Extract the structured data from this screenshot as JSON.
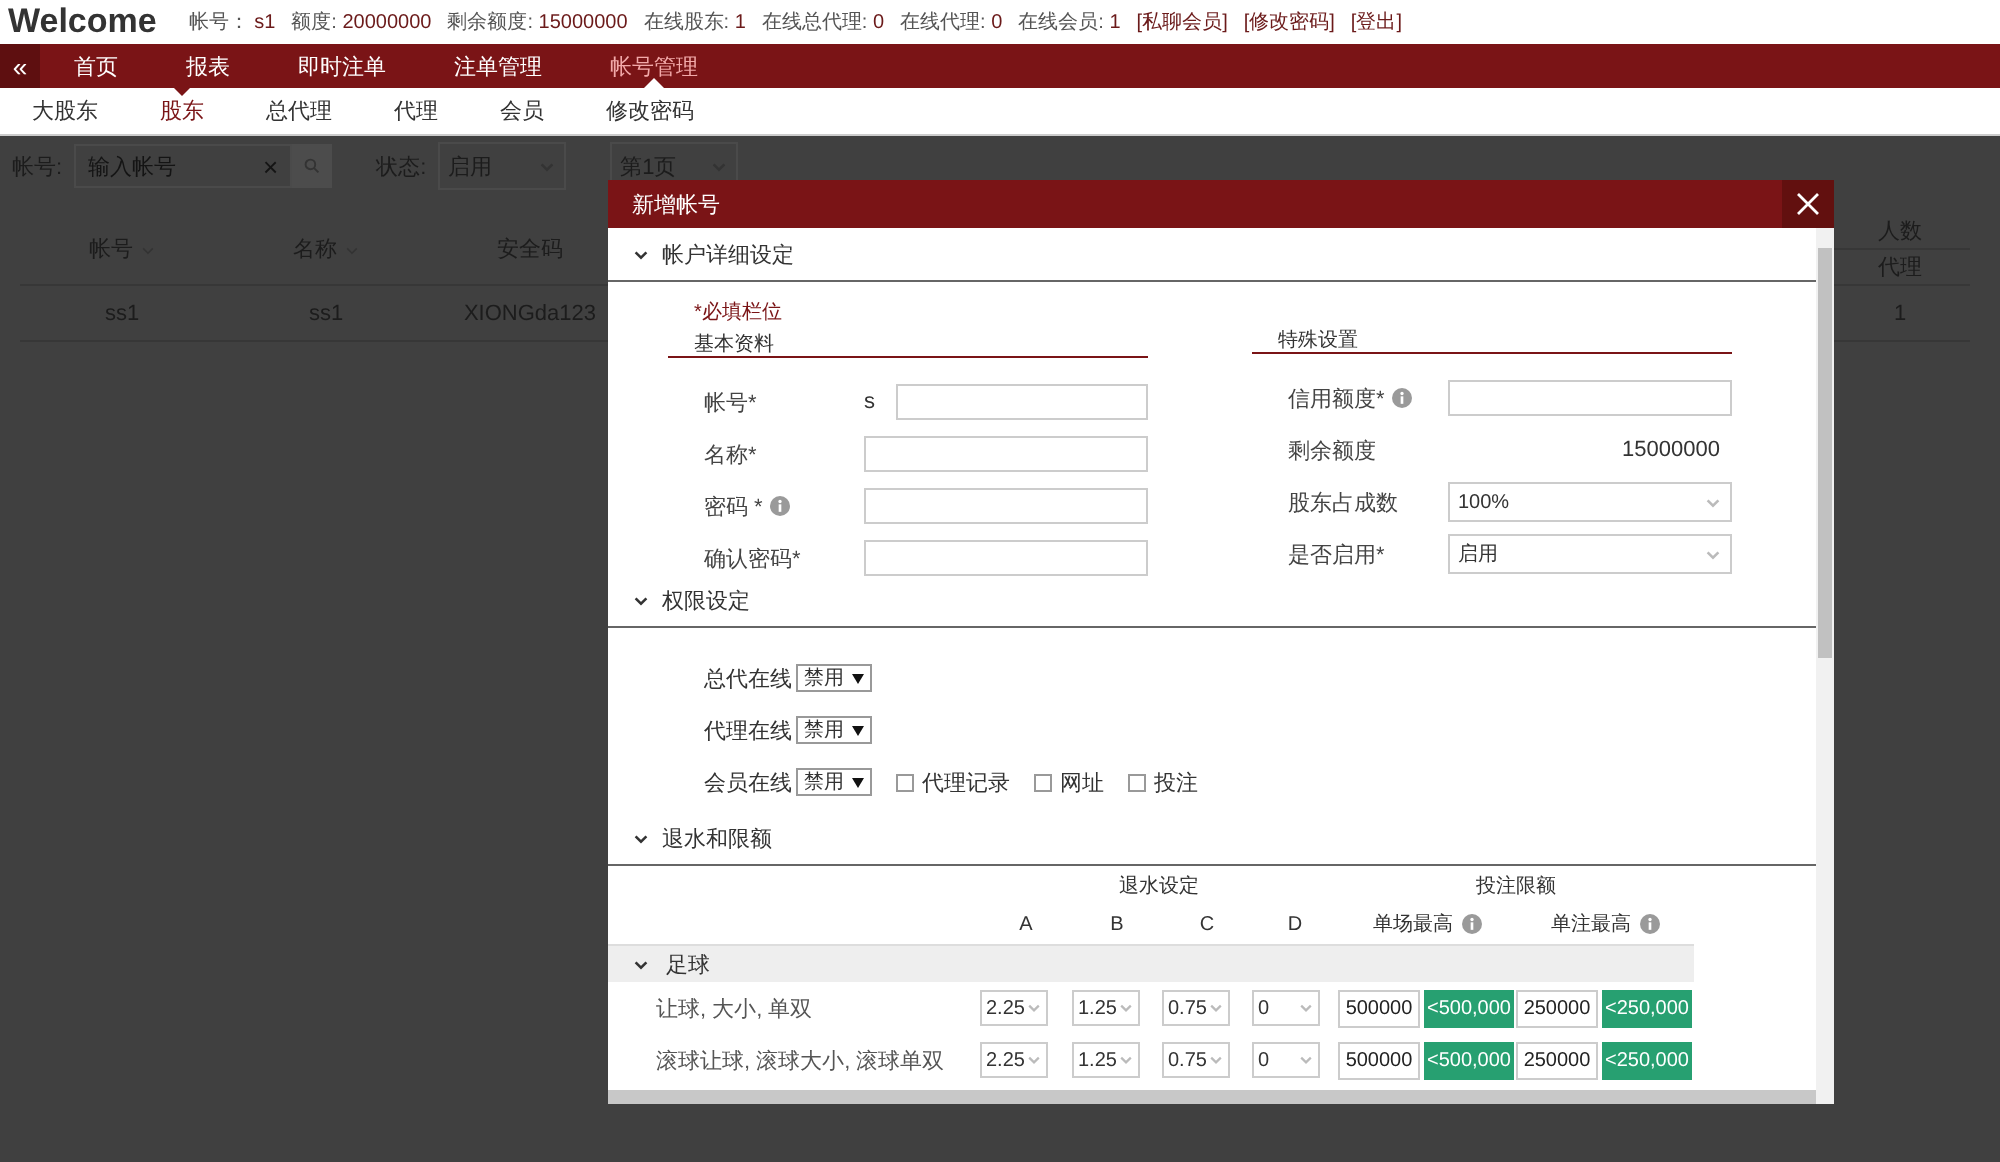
{
  "header": {
    "title": "Welcome",
    "stats": [
      {
        "label": "帐号：",
        "value": "s1"
      },
      {
        "label": "额度:",
        "value": "20000000"
      },
      {
        "label": "剩余额度:",
        "value": "15000000"
      },
      {
        "label": "在线股东:",
        "value": "1"
      },
      {
        "label": "在线总代理:",
        "value": "0"
      },
      {
        "label": "在线代理:",
        "value": "0"
      },
      {
        "label": "在线会员:",
        "value": "1"
      }
    ],
    "links": [
      "[私聊会员]",
      "[修改密码]",
      "[登出]"
    ]
  },
  "nav": {
    "collapse": "«",
    "items": [
      {
        "label": "首页",
        "selected": false
      },
      {
        "label": "报表",
        "selected": false
      },
      {
        "label": "即时注单",
        "selected": false
      },
      {
        "label": "注单管理",
        "selected": false
      },
      {
        "label": "帐号管理",
        "selected": true
      }
    ]
  },
  "subnav": [
    {
      "label": "大股东",
      "selected": false
    },
    {
      "label": "股东",
      "selected": true
    },
    {
      "label": "总代理",
      "selected": false
    },
    {
      "label": "代理",
      "selected": false
    },
    {
      "label": "会员",
      "selected": false
    },
    {
      "label": "修改密码",
      "selected": false
    }
  ],
  "filters": {
    "account_label": "帐号:",
    "placeholder": "输入帐号",
    "clear": "×",
    "status_label": "状态:",
    "status": "启用",
    "page": "第1页"
  },
  "table": {
    "columns": [
      {
        "label": "帐号",
        "sortable": true
      },
      {
        "label": "名称",
        "sortable": true
      },
      {
        "label": "安全码",
        "sortable": false
      }
    ],
    "last_column": {
      "title": "人数",
      "sub": "代理"
    },
    "rows": [
      {
        "cells": [
          "ss1",
          "ss1",
          "XIONGda123"
        ],
        "last": "1"
      }
    ]
  },
  "dialog": {
    "title": "新增帐号",
    "account": {
      "title": "帐户详细设定",
      "expanded": true,
      "required_note": "*必填栏位",
      "basic_title": "基本资料",
      "special_title": "特殊设置",
      "basic_fields": [
        {
          "label": "帐号*",
          "prefix": "s",
          "info": false
        },
        {
          "label": "名称*",
          "info": false
        },
        {
          "label": "密码 *",
          "info": true
        },
        {
          "label": "确认密码*",
          "info": false
        }
      ],
      "special_fields": [
        {
          "kind": "input",
          "label": "信用额度*",
          "info": true
        },
        {
          "kind": "text",
          "label": "剩余额度",
          "value": "15000000"
        },
        {
          "kind": "select",
          "label": "股东占成数",
          "value": "100%"
        },
        {
          "kind": "select",
          "label": "是否启用*",
          "value": "启用"
        }
      ]
    },
    "permissions": {
      "title": "权限设定",
      "expanded": true,
      "rows": [
        {
          "label": "总代在线",
          "value": "禁用"
        },
        {
          "label": "代理在线",
          "value": "禁用"
        },
        {
          "label": "会员在线",
          "value": "禁用",
          "checkboxes": [
            {
              "label": "代理记录",
              "checked": false
            },
            {
              "label": "网址",
              "checked": false
            },
            {
              "label": "投注",
              "checked": false
            }
          ]
        }
      ]
    },
    "limits": {
      "title": "退水和限额",
      "expanded": true,
      "group_rebate": "退水设定",
      "group_limit": "投注限额",
      "rebate_columns": [
        "A",
        "B",
        "C",
        "D"
      ],
      "limit_columns": [
        {
          "label": "单场最高",
          "info": true
        },
        {
          "label": "单注最高",
          "info": true
        }
      ],
      "categories": [
        {
          "name": "足球",
          "expanded": true,
          "rows": [
            {
              "label": "让球, 大小, 单双",
              "rebates": [
                "2.25",
                "1.25",
                "0.75",
                "0"
              ],
              "match_max": "500000",
              "match_badge": "<500,000",
              "bet_max": "250000",
              "bet_badge": "<250,000"
            },
            {
              "label": "滚球让球, 滚球大小, 滚球单双",
              "rebates": [
                "2.25",
                "1.25",
                "0.75",
                "0"
              ],
              "match_max": "500000",
              "match_badge": "<500,000",
              "bet_max": "250000",
              "bet_badge": "<250,000"
            }
          ]
        }
      ]
    }
  }
}
